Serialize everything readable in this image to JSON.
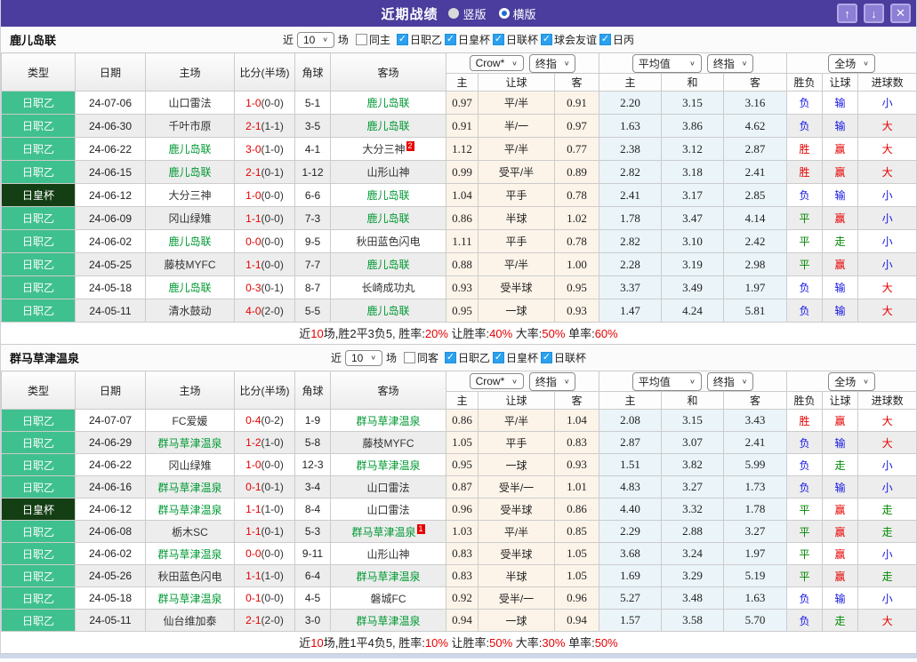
{
  "titlebar": {
    "title": "近期战绩",
    "radio_vertical": "竖版",
    "radio_horizontal": "横版"
  },
  "icons": {
    "up": "↑",
    "down": "↓",
    "close": "✕",
    "chevron": "∨",
    "check": "✓"
  },
  "filters": {
    "near_label": "近",
    "count": "10",
    "games_label": "场"
  },
  "controls": {
    "crow": "Crow*",
    "final": "终指",
    "avg": "平均值",
    "full": "全场"
  },
  "columns": {
    "type": "类型",
    "date": "日期",
    "home": "主场",
    "score": "比分(半场)",
    "corner": "角球",
    "away": "客场",
    "home_odds": "主",
    "handicap": "让球",
    "away_odds": "客",
    "avg_home": "主",
    "avg_draw": "和",
    "avg_away": "客",
    "result": "胜负",
    "handicap_result": "让球",
    "goals": "进球数"
  },
  "colors": {
    "accent_purple": "#4a3d9d",
    "league_green": "#3fc08f",
    "cup_dark_green": "#143f14",
    "win_red": "#e60000",
    "lose_blue": "#1414e6",
    "draw_green": "#008800",
    "team_green": "#009933",
    "checkbox_blue": "#2aa0ef"
  },
  "teams": [
    {
      "name": "鹿儿岛联",
      "same_label": "同主",
      "leagues": [
        "日职乙",
        "日皇杯",
        "日联杯",
        "球会友谊",
        "日丙"
      ],
      "rows": [
        {
          "t": "日职乙",
          "cup": false,
          "d": "24-07-06",
          "h": "山口雷法",
          "hh": false,
          "hb": "",
          "s": "1-0",
          "sh": "(0-0)",
          "c": "5-1",
          "a": "鹿儿岛联",
          "ah": true,
          "ab": "",
          "o1": "0.97",
          "hc": "平/半",
          "o2": "0.91",
          "a1": "2.20",
          "a2": "3.15",
          "a3": "3.16",
          "r1": {
            "t": "负",
            "c": "blue"
          },
          "r2": {
            "t": "输",
            "c": "blue"
          },
          "r3": {
            "t": "小",
            "c": "blue"
          }
        },
        {
          "t": "日职乙",
          "cup": false,
          "d": "24-06-30",
          "h": "千叶市原",
          "hh": false,
          "hb": "",
          "s": "2-1",
          "sh": "(1-1)",
          "c": "3-5",
          "a": "鹿儿岛联",
          "ah": true,
          "ab": "",
          "o1": "0.91",
          "hc": "半/一",
          "o2": "0.97",
          "a1": "1.63",
          "a2": "3.86",
          "a3": "4.62",
          "r1": {
            "t": "负",
            "c": "blue"
          },
          "r2": {
            "t": "输",
            "c": "blue"
          },
          "r3": {
            "t": "大",
            "c": "red"
          }
        },
        {
          "t": "日职乙",
          "cup": false,
          "d": "24-06-22",
          "h": "鹿儿岛联",
          "hh": true,
          "hb": "",
          "s": "3-0",
          "sh": "(1-0)",
          "c": "4-1",
          "a": "大分三神",
          "ah": false,
          "ab": "2",
          "o1": "1.12",
          "hc": "平/半",
          "o2": "0.77",
          "a1": "2.38",
          "a2": "3.12",
          "a3": "2.87",
          "r1": {
            "t": "胜",
            "c": "red"
          },
          "r2": {
            "t": "赢",
            "c": "red"
          },
          "r3": {
            "t": "大",
            "c": "red"
          }
        },
        {
          "t": "日职乙",
          "cup": false,
          "d": "24-06-15",
          "h": "鹿儿岛联",
          "hh": true,
          "hb": "",
          "s": "2-1",
          "sh": "(0-1)",
          "c": "1-12",
          "a": "山形山神",
          "ah": false,
          "ab": "",
          "o1": "0.99",
          "hc": "受平/半",
          "o2": "0.89",
          "a1": "2.82",
          "a2": "3.18",
          "a3": "2.41",
          "r1": {
            "t": "胜",
            "c": "red"
          },
          "r2": {
            "t": "赢",
            "c": "red"
          },
          "r3": {
            "t": "大",
            "c": "red"
          }
        },
        {
          "t": "日皇杯",
          "cup": true,
          "d": "24-06-12",
          "h": "大分三神",
          "hh": false,
          "hb": "",
          "s": "1-0",
          "sh": "(0-0)",
          "c": "6-6",
          "a": "鹿儿岛联",
          "ah": true,
          "ab": "",
          "o1": "1.04",
          "hc": "平手",
          "o2": "0.78",
          "a1": "2.41",
          "a2": "3.17",
          "a3": "2.85",
          "r1": {
            "t": "负",
            "c": "blue"
          },
          "r2": {
            "t": "输",
            "c": "blue"
          },
          "r3": {
            "t": "小",
            "c": "blue"
          }
        },
        {
          "t": "日职乙",
          "cup": false,
          "d": "24-06-09",
          "h": "冈山绿雉",
          "hh": false,
          "hb": "",
          "s": "1-1",
          "sh": "(0-0)",
          "c": "7-3",
          "a": "鹿儿岛联",
          "ah": true,
          "ab": "",
          "o1": "0.86",
          "hc": "半球",
          "o2": "1.02",
          "a1": "1.78",
          "a2": "3.47",
          "a3": "4.14",
          "r1": {
            "t": "平",
            "c": "green"
          },
          "r2": {
            "t": "赢",
            "c": "red"
          },
          "r3": {
            "t": "小",
            "c": "blue"
          }
        },
        {
          "t": "日职乙",
          "cup": false,
          "d": "24-06-02",
          "h": "鹿儿岛联",
          "hh": true,
          "hb": "",
          "s": "0-0",
          "sh": "(0-0)",
          "c": "9-5",
          "a": "秋田蓝色闪电",
          "ah": false,
          "ab": "",
          "o1": "1.11",
          "hc": "平手",
          "o2": "0.78",
          "a1": "2.82",
          "a2": "3.10",
          "a3": "2.42",
          "r1": {
            "t": "平",
            "c": "green"
          },
          "r2": {
            "t": "走",
            "c": "green"
          },
          "r3": {
            "t": "小",
            "c": "blue"
          }
        },
        {
          "t": "日职乙",
          "cup": false,
          "d": "24-05-25",
          "h": "藤枝MYFC",
          "hh": false,
          "hb": "",
          "s": "1-1",
          "sh": "(0-0)",
          "c": "7-7",
          "a": "鹿儿岛联",
          "ah": true,
          "ab": "",
          "o1": "0.88",
          "hc": "平/半",
          "o2": "1.00",
          "a1": "2.28",
          "a2": "3.19",
          "a3": "2.98",
          "r1": {
            "t": "平",
            "c": "green"
          },
          "r2": {
            "t": "赢",
            "c": "red"
          },
          "r3": {
            "t": "小",
            "c": "blue"
          }
        },
        {
          "t": "日职乙",
          "cup": false,
          "d": "24-05-18",
          "h": "鹿儿岛联",
          "hh": true,
          "hb": "",
          "s": "0-3",
          "sh": "(0-1)",
          "c": "8-7",
          "a": "长崎成功丸",
          "ah": false,
          "ab": "",
          "o1": "0.93",
          "hc": "受半球",
          "o2": "0.95",
          "a1": "3.37",
          "a2": "3.49",
          "a3": "1.97",
          "r1": {
            "t": "负",
            "c": "blue"
          },
          "r2": {
            "t": "输",
            "c": "blue"
          },
          "r3": {
            "t": "大",
            "c": "red"
          }
        },
        {
          "t": "日职乙",
          "cup": false,
          "d": "24-05-11",
          "h": "清水鼓动",
          "hh": false,
          "hb": "",
          "s": "4-0",
          "sh": "(2-0)",
          "c": "5-5",
          "a": "鹿儿岛联",
          "ah": true,
          "ab": "",
          "o1": "0.95",
          "hc": "一球",
          "o2": "0.93",
          "a1": "1.47",
          "a2": "4.24",
          "a3": "5.81",
          "r1": {
            "t": "负",
            "c": "blue"
          },
          "r2": {
            "t": "输",
            "c": "blue"
          },
          "r3": {
            "t": "大",
            "c": "red"
          }
        }
      ],
      "summary": [
        {
          "t": "近",
          "c": "black"
        },
        {
          "t": "10",
          "c": "red"
        },
        {
          "t": "场,胜2平3负5, 胜率:",
          "c": "black"
        },
        {
          "t": "20%",
          "c": "red"
        },
        {
          "t": " 让胜率:",
          "c": "black"
        },
        {
          "t": "40%",
          "c": "red"
        },
        {
          "t": " 大率:",
          "c": "black"
        },
        {
          "t": "50%",
          "c": "red"
        },
        {
          "t": " 单率:",
          "c": "black"
        },
        {
          "t": "60%",
          "c": "red"
        }
      ]
    },
    {
      "name": "群马草津温泉",
      "same_label": "同客",
      "leagues": [
        "日职乙",
        "日皇杯",
        "日联杯"
      ],
      "rows": [
        {
          "t": "日职乙",
          "cup": false,
          "d": "24-07-07",
          "h": "FC爱媛",
          "hh": false,
          "hb": "",
          "s": "0-4",
          "sh": "(0-2)",
          "c": "1-9",
          "a": "群马草津温泉",
          "ah": true,
          "ab": "",
          "o1": "0.86",
          "hc": "平/半",
          "o2": "1.04",
          "a1": "2.08",
          "a2": "3.15",
          "a3": "3.43",
          "r1": {
            "t": "胜",
            "c": "red"
          },
          "r2": {
            "t": "赢",
            "c": "red"
          },
          "r3": {
            "t": "大",
            "c": "red"
          }
        },
        {
          "t": "日职乙",
          "cup": false,
          "d": "24-06-29",
          "h": "群马草津温泉",
          "hh": true,
          "hb": "",
          "s": "1-2",
          "sh": "(1-0)",
          "c": "5-8",
          "a": "藤枝MYFC",
          "ah": false,
          "ab": "",
          "o1": "1.05",
          "hc": "平手",
          "o2": "0.83",
          "a1": "2.87",
          "a2": "3.07",
          "a3": "2.41",
          "r1": {
            "t": "负",
            "c": "blue"
          },
          "r2": {
            "t": "输",
            "c": "blue"
          },
          "r3": {
            "t": "大",
            "c": "red"
          }
        },
        {
          "t": "日职乙",
          "cup": false,
          "d": "24-06-22",
          "h": "冈山绿雉",
          "hh": false,
          "hb": "",
          "s": "1-0",
          "sh": "(0-0)",
          "c": "12-3",
          "a": "群马草津温泉",
          "ah": true,
          "ab": "",
          "o1": "0.95",
          "hc": "一球",
          "o2": "0.93",
          "a1": "1.51",
          "a2": "3.82",
          "a3": "5.99",
          "r1": {
            "t": "负",
            "c": "blue"
          },
          "r2": {
            "t": "走",
            "c": "green"
          },
          "r3": {
            "t": "小",
            "c": "blue"
          }
        },
        {
          "t": "日职乙",
          "cup": false,
          "d": "24-06-16",
          "h": "群马草津温泉",
          "hh": true,
          "hb": "",
          "s": "0-1",
          "sh": "(0-1)",
          "c": "3-4",
          "a": "山口雷法",
          "ah": false,
          "ab": "",
          "o1": "0.87",
          "hc": "受半/一",
          "o2": "1.01",
          "a1": "4.83",
          "a2": "3.27",
          "a3": "1.73",
          "r1": {
            "t": "负",
            "c": "blue"
          },
          "r2": {
            "t": "输",
            "c": "blue"
          },
          "r3": {
            "t": "小",
            "c": "blue"
          }
        },
        {
          "t": "日皇杯",
          "cup": true,
          "d": "24-06-12",
          "h": "群马草津温泉",
          "hh": true,
          "hb": "",
          "s": "1-1",
          "sh": "(1-0)",
          "c": "8-4",
          "a": "山口雷法",
          "ah": false,
          "ab": "",
          "o1": "0.96",
          "hc": "受半球",
          "o2": "0.86",
          "a1": "4.40",
          "a2": "3.32",
          "a3": "1.78",
          "r1": {
            "t": "平",
            "c": "green"
          },
          "r2": {
            "t": "赢",
            "c": "red"
          },
          "r3": {
            "t": "走",
            "c": "green"
          }
        },
        {
          "t": "日职乙",
          "cup": false,
          "d": "24-06-08",
          "h": "栃木SC",
          "hh": false,
          "hb": "",
          "s": "1-1",
          "sh": "(0-1)",
          "c": "5-3",
          "a": "群马草津温泉",
          "ah": true,
          "ab": "1",
          "o1": "1.03",
          "hc": "平/半",
          "o2": "0.85",
          "a1": "2.29",
          "a2": "2.88",
          "a3": "3.27",
          "r1": {
            "t": "平",
            "c": "green"
          },
          "r2": {
            "t": "赢",
            "c": "red"
          },
          "r3": {
            "t": "走",
            "c": "green"
          }
        },
        {
          "t": "日职乙",
          "cup": false,
          "d": "24-06-02",
          "h": "群马草津温泉",
          "hh": true,
          "hb": "",
          "s": "0-0",
          "sh": "(0-0)",
          "c": "9-11",
          "a": "山形山神",
          "ah": false,
          "ab": "",
          "o1": "0.83",
          "hc": "受半球",
          "o2": "1.05",
          "a1": "3.68",
          "a2": "3.24",
          "a3": "1.97",
          "r1": {
            "t": "平",
            "c": "green"
          },
          "r2": {
            "t": "赢",
            "c": "red"
          },
          "r3": {
            "t": "小",
            "c": "blue"
          }
        },
        {
          "t": "日职乙",
          "cup": false,
          "d": "24-05-26",
          "h": "秋田蓝色闪电",
          "hh": false,
          "hb": "",
          "s": "1-1",
          "sh": "(1-0)",
          "c": "6-4",
          "a": "群马草津温泉",
          "ah": true,
          "ab": "",
          "o1": "0.83",
          "hc": "半球",
          "o2": "1.05",
          "a1": "1.69",
          "a2": "3.29",
          "a3": "5.19",
          "r1": {
            "t": "平",
            "c": "green"
          },
          "r2": {
            "t": "赢",
            "c": "red"
          },
          "r3": {
            "t": "走",
            "c": "green"
          }
        },
        {
          "t": "日职乙",
          "cup": false,
          "d": "24-05-18",
          "h": "群马草津温泉",
          "hh": true,
          "hb": "",
          "s": "0-1",
          "sh": "(0-0)",
          "c": "4-5",
          "a": "磐城FC",
          "ah": false,
          "ab": "",
          "o1": "0.92",
          "hc": "受半/一",
          "o2": "0.96",
          "a1": "5.27",
          "a2": "3.48",
          "a3": "1.63",
          "r1": {
            "t": "负",
            "c": "blue"
          },
          "r2": {
            "t": "输",
            "c": "blue"
          },
          "r3": {
            "t": "小",
            "c": "blue"
          }
        },
        {
          "t": "日职乙",
          "cup": false,
          "d": "24-05-11",
          "h": "仙台维加泰",
          "hh": false,
          "hb": "",
          "s": "2-1",
          "sh": "(2-0)",
          "c": "3-0",
          "a": "群马草津温泉",
          "ah": true,
          "ab": "",
          "o1": "0.94",
          "hc": "一球",
          "o2": "0.94",
          "a1": "1.57",
          "a2": "3.58",
          "a3": "5.70",
          "r1": {
            "t": "负",
            "c": "blue"
          },
          "r2": {
            "t": "走",
            "c": "green"
          },
          "r3": {
            "t": "大",
            "c": "red"
          }
        }
      ],
      "summary": [
        {
          "t": "近",
          "c": "black"
        },
        {
          "t": "10",
          "c": "red"
        },
        {
          "t": "场,胜1平4负5, 胜率:",
          "c": "black"
        },
        {
          "t": "10%",
          "c": "red"
        },
        {
          "t": " 让胜率:",
          "c": "black"
        },
        {
          "t": "50%",
          "c": "red"
        },
        {
          "t": " 大率:",
          "c": "black"
        },
        {
          "t": "30%",
          "c": "red"
        },
        {
          "t": " 单率:",
          "c": "black"
        },
        {
          "t": "50%",
          "c": "red"
        }
      ]
    }
  ]
}
